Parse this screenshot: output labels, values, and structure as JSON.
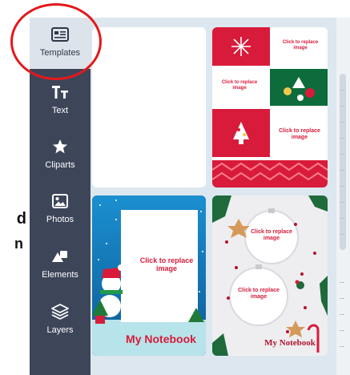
{
  "page_side_text": {
    "line1": "d",
    "line2": "n"
  },
  "sidebar": {
    "items": [
      {
        "label": "Templates",
        "icon": "template-card-icon",
        "active": true
      },
      {
        "label": "Text",
        "icon": "text-tt-icon",
        "active": false
      },
      {
        "label": "Cliparts",
        "icon": "star-icon",
        "active": false
      },
      {
        "label": "Photos",
        "icon": "photo-icon",
        "active": false
      },
      {
        "label": "Elements",
        "icon": "shapes-icon",
        "active": false
      },
      {
        "label": "Layers",
        "icon": "layers-icon",
        "active": false
      }
    ]
  },
  "templates": {
    "cards": [
      {
        "name": "blank"
      },
      {
        "name": "christmas-collage",
        "labels": [
          "Click to replace image",
          "Click to replace image",
          "Click to replace image"
        ]
      },
      {
        "name": "snowman-notebook",
        "placeholder": "Click to replace image",
        "title": "My Notebook"
      },
      {
        "name": "ornaments-notebook",
        "placeholders": [
          "Click to replace image",
          "Click to replace image"
        ],
        "title": "My Notebook"
      }
    ]
  },
  "colors": {
    "sidebar_bg": "#3d4559",
    "panel_bg": "#dce7ef",
    "accent_red": "#e2191c",
    "christmas_red": "#d81b3a",
    "christmas_green": "#0e6b3b",
    "snow_blue": "#1a6fa8"
  }
}
